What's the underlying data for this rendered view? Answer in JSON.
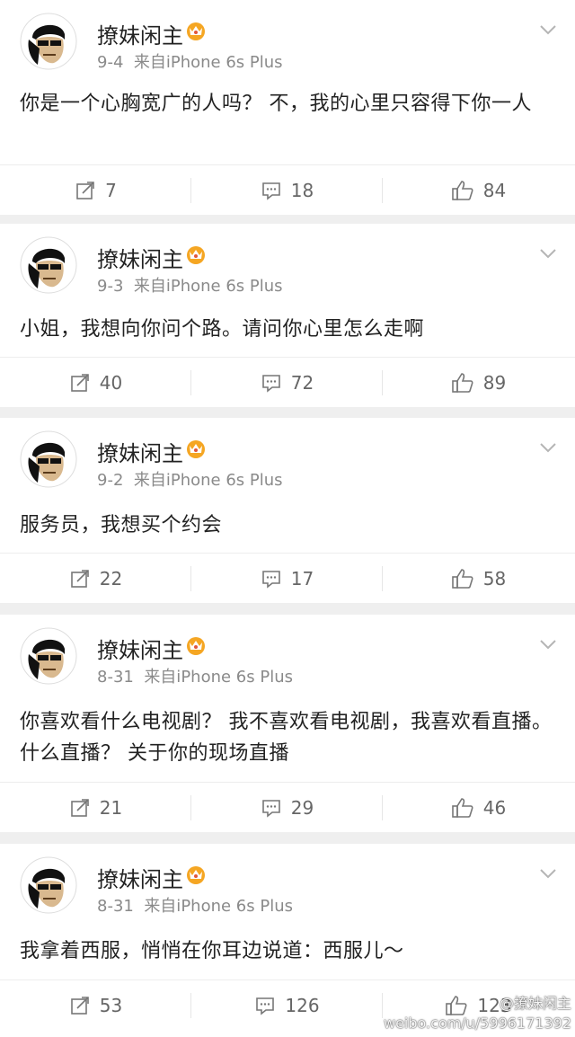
{
  "posts": [
    {
      "username": "撩妹闲主",
      "date": "9-4",
      "source": "来自iPhone 6s Plus",
      "text": "你是一个心胸宽广的人吗？  不，我的心里只容得下你一人",
      "reposts": "7",
      "comments": "18",
      "likes": "84"
    },
    {
      "username": "撩妹闲主",
      "date": "9-3",
      "source": "来自iPhone 6s Plus",
      "text": "小姐，我想向你问个路。请问你心里怎么走啊",
      "reposts": "40",
      "comments": "72",
      "likes": "89"
    },
    {
      "username": "撩妹闲主",
      "date": "9-2",
      "source": "来自iPhone 6s Plus",
      "text": "服务员，我想买个约会",
      "reposts": "22",
      "comments": "17",
      "likes": "58"
    },
    {
      "username": "撩妹闲主",
      "date": "8-31",
      "source": "来自iPhone 6s Plus",
      "text": "你喜欢看什么电视剧？ 我不喜欢看电视剧，我喜欢看直播。  什么直播？  关于你的现场直播",
      "reposts": "21",
      "comments": "29",
      "likes": "46"
    },
    {
      "username": "撩妹闲主",
      "date": "8-31",
      "source": "来自iPhone 6s Plus",
      "text": "我拿着西服，悄悄在你耳边说道：西服儿～",
      "reposts": "53",
      "comments": "126",
      "likes": "123"
    }
  ],
  "watermark": {
    "line1": "@撩妹闲主",
    "line2": "weibo.com/u/5996171392"
  },
  "icons": {
    "avatar": "sunglasses-man-avatar",
    "badge": "vip-crown-icon",
    "menu": "chevron-down-icon",
    "repost": "repost-icon",
    "comment": "comment-icon",
    "like": "thumbs-up-icon"
  },
  "colors": {
    "background": "#efefef",
    "card": "#ffffff",
    "meta": "#8a8a8a",
    "vip": "#f5a623"
  }
}
